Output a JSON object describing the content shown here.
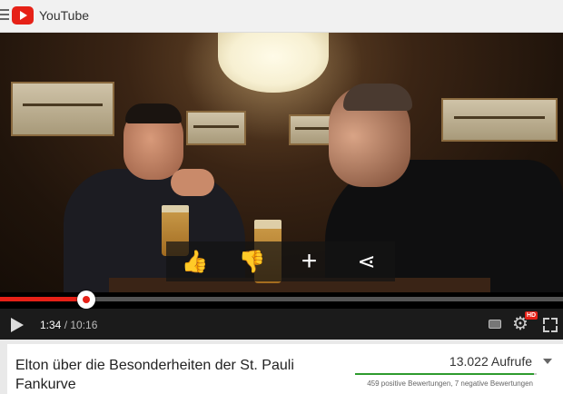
{
  "header": {
    "app_title": "YouTube"
  },
  "player": {
    "current_time": "1:34",
    "separator": " / ",
    "duration": "10:16",
    "progress_fraction": 0.153,
    "hd_label": "HD",
    "overlay_actions": [
      {
        "name": "like",
        "icon": "thumbs-up-icon",
        "glyph": "👍"
      },
      {
        "name": "dislike",
        "icon": "thumbs-down-icon",
        "glyph": "👎"
      },
      {
        "name": "add",
        "icon": "plus-icon",
        "glyph": "+"
      },
      {
        "name": "share",
        "icon": "share-icon",
        "glyph": "⋖"
      }
    ]
  },
  "video": {
    "title": "Elton über die Besonderheiten der St. Pauli Fankurve",
    "views": "13.022 Aufrufe",
    "ratings": "459 positive Bewertungen, 7 negative Bewertungen",
    "like_fraction": 0.985
  },
  "colors": {
    "brand": "#e62117",
    "like_bar": "#2e9b2e"
  }
}
